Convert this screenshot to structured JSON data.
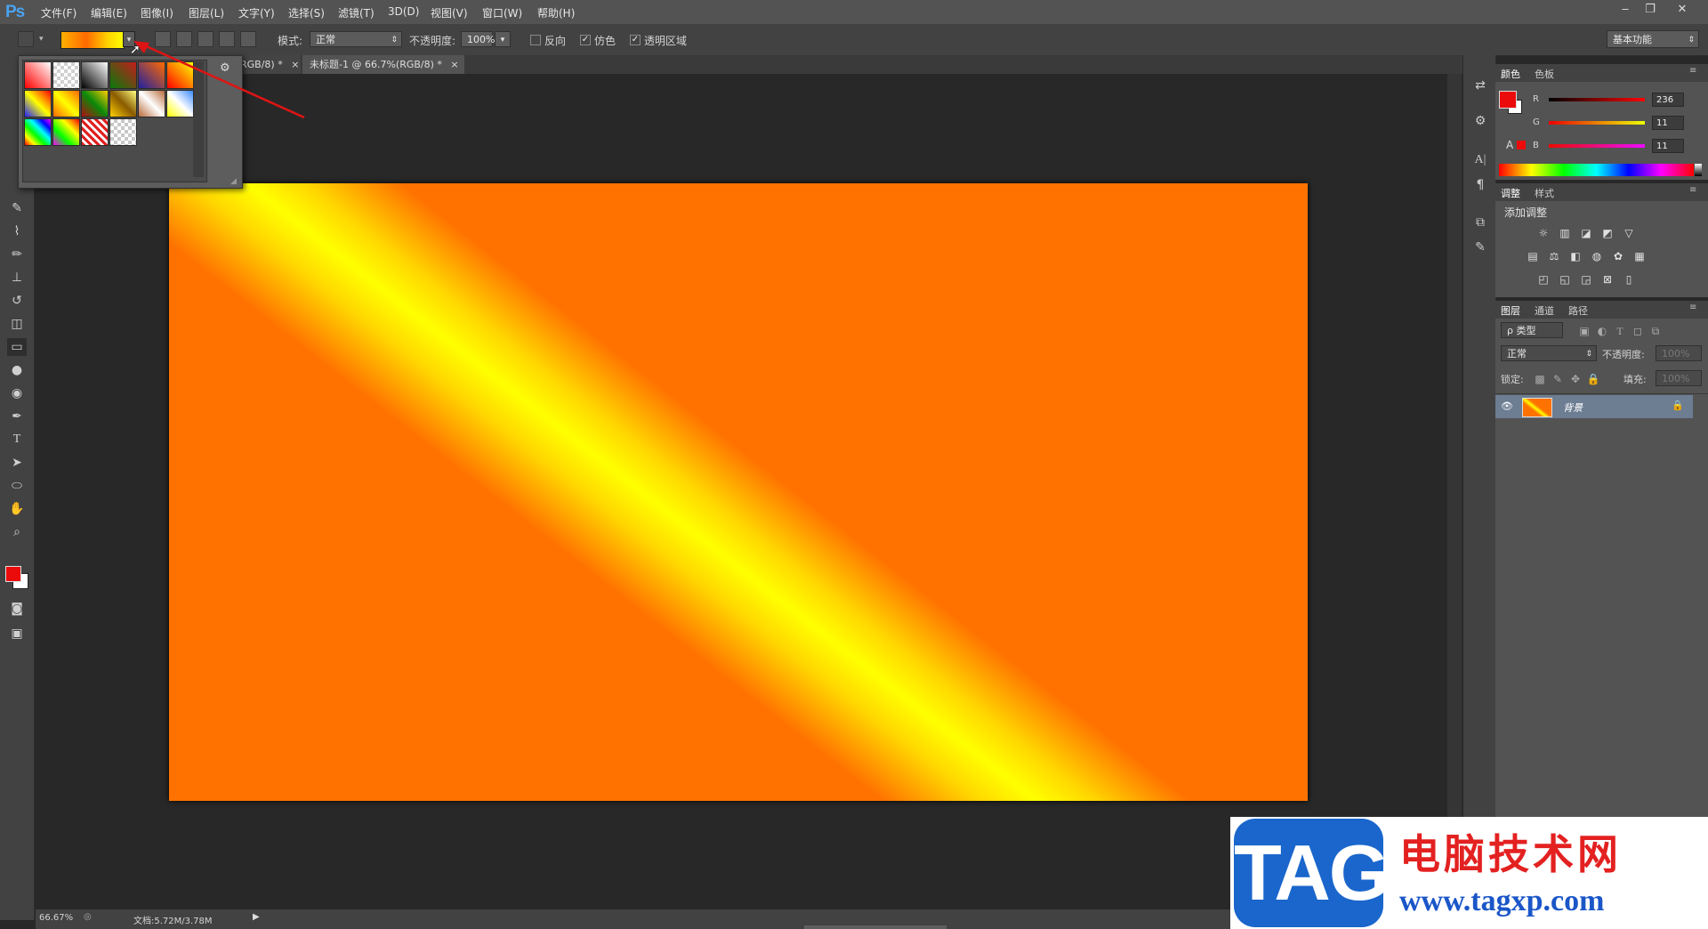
{
  "app": {
    "logo": "Ps"
  },
  "menu": [
    "文件(F)",
    "编辑(E)",
    "图像(I)",
    "图层(L)",
    "文字(Y)",
    "选择(S)",
    "滤镜(T)",
    "3D(D)",
    "视图(V)",
    "窗口(W)",
    "帮助(H)"
  ],
  "window_controls": {
    "minimize": "‒",
    "restore": "❐",
    "close": "✕"
  },
  "options": {
    "mode_label": "模式:",
    "mode_value": "正常",
    "opacity_label": "不透明度:",
    "opacity_value": "100%",
    "reverse_label": "反向",
    "dither_label": "仿色",
    "transparency_label": "透明区域",
    "reverse_checked": false,
    "dither_checked": true,
    "transparency_checked": true,
    "workspace": "基本功能"
  },
  "tabs": [
    {
      "label": "RGB/8) *",
      "close": "×"
    },
    {
      "label": "未标题-1 @ 66.7%(RGB/8) *",
      "close": "×"
    }
  ],
  "tools": [
    "eyedropper-icon",
    "healing-brush-icon",
    "brush-icon",
    "stamp-icon",
    "history-brush-icon",
    "eraser-icon",
    "gradient-icon",
    "blur-icon",
    "dodge-icon",
    "pen-icon",
    "type-icon",
    "path-select-icon",
    "ellipse-icon",
    "hand-icon",
    "zoom-icon"
  ],
  "colors": {
    "foreground": "#ec0b0b",
    "background": "#ffffff",
    "accent": "#ff7200"
  },
  "color_panel": {
    "tabs": [
      "颜色",
      "色板"
    ],
    "channels": [
      {
        "label": "R",
        "value": "236"
      },
      {
        "label": "G",
        "value": "11"
      },
      {
        "label": "B",
        "value": "11"
      }
    ]
  },
  "adjust_panel": {
    "tabs": [
      "调整",
      "样式"
    ],
    "add_label": "添加调整"
  },
  "layers_panel": {
    "tabs": [
      "图层",
      "通道",
      "路径"
    ],
    "filter_label": "ρ 类型",
    "blend_mode": "正常",
    "opacity_label": "不透明度:",
    "opacity_value": "100%",
    "lock_label": "锁定:",
    "fill_label": "填充:",
    "fill_value": "100%",
    "layer_name": "背景"
  },
  "status": {
    "zoom": "66.67%",
    "doc_info": "文档:5.72M/3.78M"
  },
  "watermark": {
    "tag": "TAG",
    "cn": "电脑技术网",
    "url": "www.tagxp.com"
  }
}
